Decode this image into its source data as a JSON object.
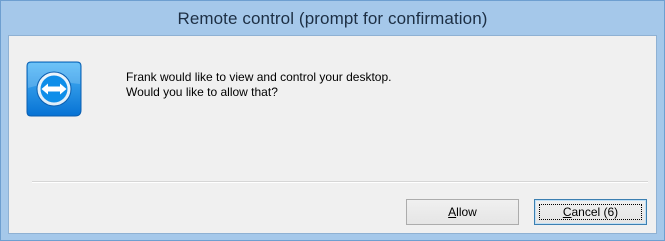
{
  "window": {
    "title": "Remote control (prompt for confirmation)"
  },
  "app_icon": "teamviewer-icon",
  "message": {
    "line1": "Frank would like to view and control your desktop.",
    "line2": "Would you like to allow that?"
  },
  "buttons": {
    "allow": {
      "accel": "A",
      "rest": "llow"
    },
    "cancel": {
      "accel": "C",
      "rest": "ancel (6)"
    }
  },
  "colors": {
    "frame": "#a5c8ea",
    "client_bg": "#f0f0f0",
    "icon_blue": "#0e8ee9"
  }
}
